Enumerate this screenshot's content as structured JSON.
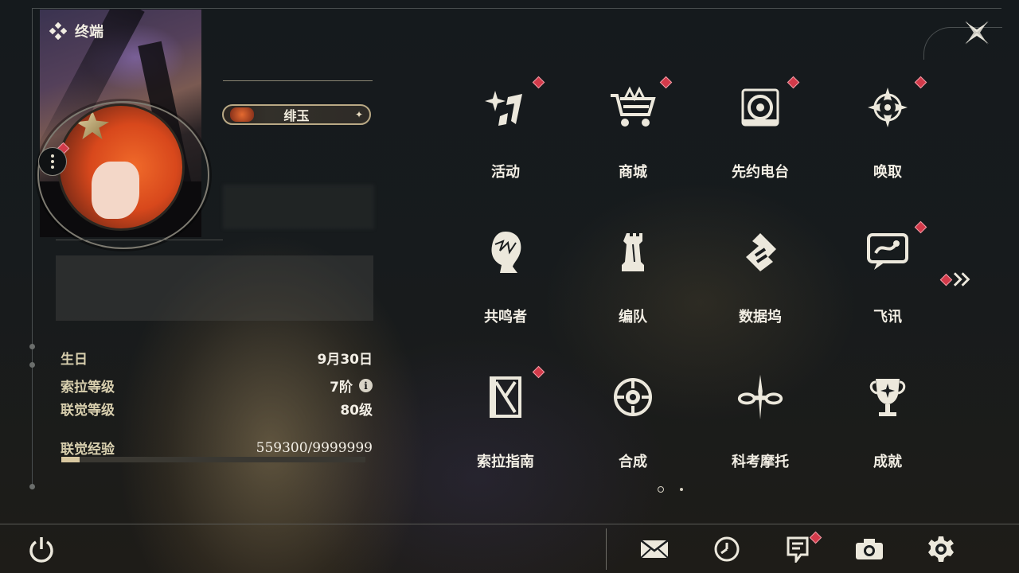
{
  "header": {
    "title": "终端"
  },
  "profile": {
    "name": "绯玉",
    "stats": [
      {
        "label": "生日",
        "value": "9月30日"
      },
      {
        "label": "索拉等级",
        "value": "7阶"
      },
      {
        "label": "联觉等级",
        "value": "80级"
      }
    ],
    "exp": {
      "label": "联觉经验",
      "value": "559300/9999999",
      "progress": 0.06
    }
  },
  "menu": [
    {
      "label": "活动",
      "icon": "sparkle-burst-icon",
      "badge": true
    },
    {
      "label": "商城",
      "icon": "shopping-cart-crown-icon",
      "badge": true
    },
    {
      "label": "先约电台",
      "icon": "radio-speaker-icon",
      "badge": true
    },
    {
      "label": "唤取",
      "icon": "compass-star-icon",
      "badge": true
    },
    {
      "label": "共鸣者",
      "icon": "character-head-icon",
      "badge": false
    },
    {
      "label": "编队",
      "icon": "chess-rook-team-icon",
      "badge": false
    },
    {
      "label": "数据坞",
      "icon": "data-dock-icon",
      "badge": false
    },
    {
      "label": "飞讯",
      "icon": "chat-bubble-icon",
      "badge": true
    },
    {
      "label": "索拉指南",
      "icon": "guidebook-icon",
      "badge": true
    },
    {
      "label": "合成",
      "icon": "synthesis-ring-icon",
      "badge": false
    },
    {
      "label": "科考摩托",
      "icon": "motorbike-icon",
      "badge": false
    },
    {
      "label": "成就",
      "icon": "trophy-icon",
      "badge": false
    }
  ],
  "bottom_bar": [
    {
      "name": "power-icon"
    },
    {
      "name": "mail-icon"
    },
    {
      "name": "clock-icon"
    },
    {
      "name": "notice-icon",
      "badge": true
    },
    {
      "name": "camera-icon"
    },
    {
      "name": "gear-icon"
    }
  ],
  "colors": {
    "badge": "#d33a4a",
    "accent": "#b9a985",
    "text": "#f2eee4"
  }
}
